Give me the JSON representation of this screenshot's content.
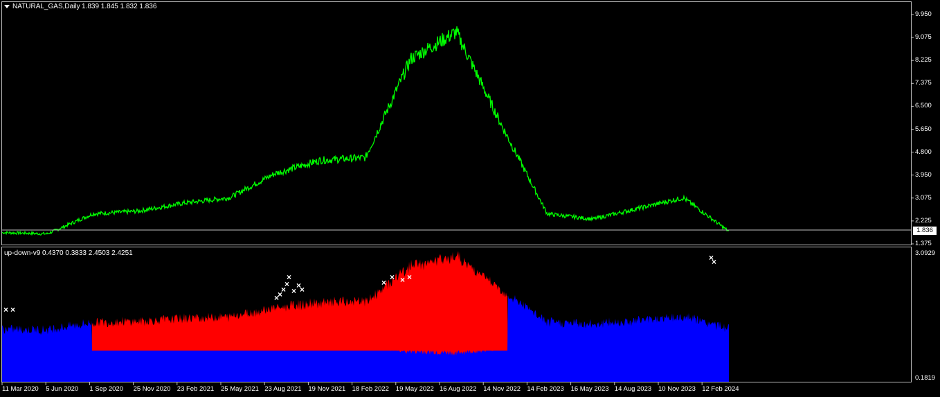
{
  "main_chart": {
    "symbol_label": "NATURAL_GAS,Daily",
    "ohlc_label": "1.839 1.845 1.832 1.836",
    "current_price": "1.836",
    "price_axis_labels": [
      "9.950",
      "9.075",
      "8.225",
      "7.375",
      "6.500",
      "5.650",
      "4.800",
      "3.950",
      "3.075",
      "2.225",
      "1.375"
    ],
    "series_color": "#00ff00"
  },
  "indicator": {
    "label": "up-down-v9 0.4370 0.3833 2.4503 2.4251",
    "axis_top": "3.0929",
    "axis_bottom": "0.1819",
    "colors": {
      "up": "#0000ff",
      "down": "#ff0000",
      "marker": "#ffffff"
    }
  },
  "time_axis_labels": [
    "11 Mar 2020",
    "5 Jun 2020",
    "1 Sep 2020",
    "25 Nov 2020",
    "23 Feb 2021",
    "25 May 2021",
    "23 Aug 2021",
    "19 Nov 2021",
    "18 Feb 2022",
    "19 May 2022",
    "16 Aug 2022",
    "14 Nov 2022",
    "14 Feb 2023",
    "16 May 2023",
    "14 Aug 2023",
    "10 Nov 2023",
    "12 Feb 2024"
  ],
  "chart_data": [
    {
      "type": "line",
      "title": "NATURAL_GAS,Daily",
      "x": [
        "11 Mar 2020",
        "5 Jun 2020",
        "1 Sep 2020",
        "25 Nov 2020",
        "23 Feb 2021",
        "25 May 2021",
        "23 Aug 2021",
        "19 Nov 2021",
        "18 Feb 2022",
        "19 May 2022",
        "16 Aug 2022",
        "14 Nov 2022",
        "14 Feb 2023",
        "16 May 2023",
        "14 Aug 2023",
        "10 Nov 2023",
        "12 Feb 2024"
      ],
      "series": [
        {
          "values": [
            1.8,
            1.75,
            2.5,
            2.6,
            2.9,
            3.1,
            4.0,
            4.5,
            4.6,
            8.3,
            9.3,
            5.8,
            2.5,
            2.3,
            2.7,
            3.1,
            1.84
          ]
        }
      ],
      "ylim": [
        1.375,
        9.95
      ]
    },
    {
      "type": "area",
      "title": "up-down-v9",
      "x": [
        "11 Mar 2020",
        "5 Jun 2020",
        "1 Sep 2020",
        "25 Nov 2020",
        "23 Feb 2021",
        "25 May 2021",
        "23 Aug 2021",
        "19 Nov 2021",
        "18 Feb 2022",
        "19 May 2022",
        "16 Aug 2022",
        "14 Nov 2022",
        "14 Feb 2023",
        "16 May 2023",
        "14 Aug 2023",
        "10 Nov 2023",
        "12 Feb 2024"
      ],
      "ylim": [
        0.1819,
        3.0929
      ]
    }
  ]
}
